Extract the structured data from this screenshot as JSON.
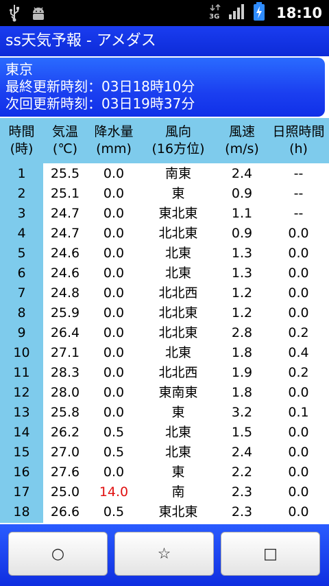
{
  "status_bar": {
    "network": "3G",
    "time": "18:10"
  },
  "app": {
    "title": "ss天気予報 - アメダス"
  },
  "info": {
    "location": "東京",
    "last_update": "最終更新時刻：03日18時10分",
    "next_update": "次回更新時刻：03日19時37分"
  },
  "table": {
    "headers": [
      {
        "line1": "時間",
        "line2": "(時)"
      },
      {
        "line1": "気温",
        "line2": "(℃)"
      },
      {
        "line1": "降水量",
        "line2": "(mm)"
      },
      {
        "line1": "風向",
        "line2": "(16方位)"
      },
      {
        "line1": "風速",
        "line2": "(m/s)"
      },
      {
        "line1": "日照時間",
        "line2": "(h)"
      }
    ],
    "rows": [
      {
        "hour": "1",
        "temp": "25.5",
        "precip": "0.0",
        "dir": "南東",
        "speed": "2.4",
        "sun": "--"
      },
      {
        "hour": "2",
        "temp": "25.1",
        "precip": "0.0",
        "dir": "東",
        "speed": "0.9",
        "sun": "--"
      },
      {
        "hour": "3",
        "temp": "24.7",
        "precip": "0.0",
        "dir": "東北東",
        "speed": "1.1",
        "sun": "--"
      },
      {
        "hour": "4",
        "temp": "24.7",
        "precip": "0.0",
        "dir": "北北東",
        "speed": "0.9",
        "sun": "0.0"
      },
      {
        "hour": "5",
        "temp": "24.6",
        "precip": "0.0",
        "dir": "北東",
        "speed": "1.3",
        "sun": "0.0"
      },
      {
        "hour": "6",
        "temp": "24.6",
        "precip": "0.0",
        "dir": "北東",
        "speed": "1.3",
        "sun": "0.0"
      },
      {
        "hour": "7",
        "temp": "24.8",
        "precip": "0.0",
        "dir": "北北西",
        "speed": "1.2",
        "sun": "0.0"
      },
      {
        "hour": "8",
        "temp": "25.9",
        "precip": "0.0",
        "dir": "北北東",
        "speed": "1.2",
        "sun": "0.0"
      },
      {
        "hour": "9",
        "temp": "26.4",
        "precip": "0.0",
        "dir": "北北東",
        "speed": "2.8",
        "sun": "0.2"
      },
      {
        "hour": "10",
        "temp": "27.1",
        "precip": "0.0",
        "dir": "北東",
        "speed": "1.8",
        "sun": "0.4"
      },
      {
        "hour": "11",
        "temp": "28.3",
        "precip": "0.0",
        "dir": "北北西",
        "speed": "1.9",
        "sun": "0.2"
      },
      {
        "hour": "12",
        "temp": "28.0",
        "precip": "0.0",
        "dir": "東南東",
        "speed": "1.8",
        "sun": "0.0"
      },
      {
        "hour": "13",
        "temp": "25.8",
        "precip": "0.0",
        "dir": "東",
        "speed": "3.2",
        "sun": "0.1"
      },
      {
        "hour": "14",
        "temp": "26.2",
        "precip": "0.5",
        "dir": "北東",
        "speed": "1.5",
        "sun": "0.0"
      },
      {
        "hour": "15",
        "temp": "27.0",
        "precip": "0.5",
        "dir": "北東",
        "speed": "2.4",
        "sun": "0.0"
      },
      {
        "hour": "16",
        "temp": "27.6",
        "precip": "0.0",
        "dir": "東",
        "speed": "2.2",
        "sun": "0.0"
      },
      {
        "hour": "17",
        "temp": "25.0",
        "precip": "14.0",
        "dir": "南",
        "speed": "2.3",
        "sun": "0.0",
        "precip_highlight": true
      },
      {
        "hour": "18",
        "temp": "26.6",
        "precip": "0.5",
        "dir": "東北東",
        "speed": "2.3",
        "sun": "0.0"
      }
    ]
  },
  "buttons": {
    "circle": "○",
    "star": "☆",
    "square": "□"
  },
  "colors": {
    "title_bar": "#1a3df0",
    "table_band": "#7ecbec",
    "highlight_precip": "#e01010"
  }
}
